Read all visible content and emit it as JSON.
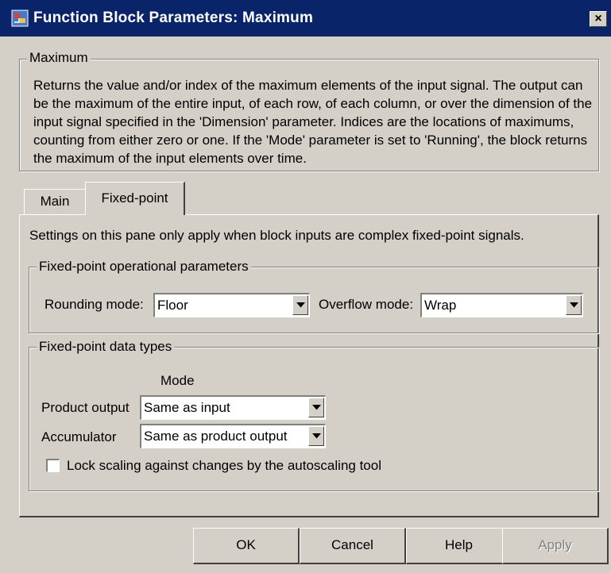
{
  "window": {
    "title": "Function Block Parameters: Maximum",
    "close_label": "×"
  },
  "block": {
    "name": "Maximum",
    "description": "Returns the value and/or index of the maximum elements of the input signal. The output can be the maximum of the entire input, of each row, of each column, or over the dimension of the input signal specified in the 'Dimension' parameter. Indices are the locations of maximums, counting from either zero or one. If the 'Mode' parameter is set to 'Running', the block returns the maximum of the input elements over time."
  },
  "tabs": [
    {
      "label": "Main",
      "active": false
    },
    {
      "label": "Fixed-point",
      "active": true
    }
  ],
  "pane": {
    "note": "Settings on this pane only apply when block inputs are complex fixed-point signals.",
    "operational": {
      "title": "Fixed-point operational parameters",
      "rounding_label": "Rounding mode:",
      "rounding_value": "Floor",
      "overflow_label": "Overflow mode:",
      "overflow_value": "Wrap"
    },
    "data_types": {
      "title": "Fixed-point data types",
      "mode_header": "Mode",
      "product_label": "Product output",
      "product_value": "Same as input",
      "accumulator_label": "Accumulator",
      "accumulator_value": "Same as product output",
      "lock_label": "Lock scaling against changes by the autoscaling tool",
      "lock_checked": false
    }
  },
  "buttons": {
    "ok": "OK",
    "cancel": "Cancel",
    "help": "Help",
    "apply": "Apply"
  },
  "colors": {
    "titlebar": "#0a246a",
    "face": "#d4d0c8"
  }
}
